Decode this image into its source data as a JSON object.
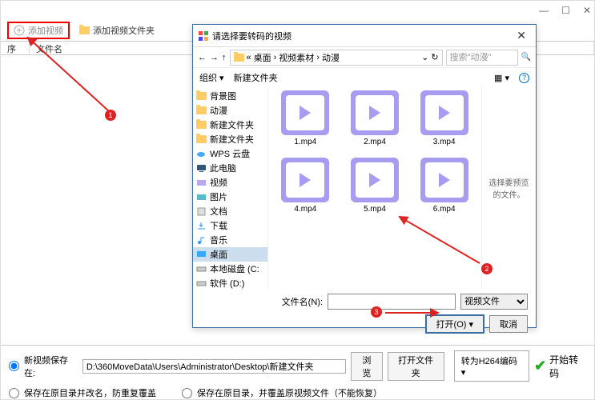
{
  "titlebar": {
    "min": "—",
    "max": "☐",
    "close": "✕"
  },
  "toolbar": {
    "add_video": "添加视频",
    "add_folder": "添加视频文件夹"
  },
  "list_header": {
    "index": "序号",
    "name": "文件名"
  },
  "dialog": {
    "title": "请选择要转码的视频",
    "close": "✕",
    "nav": {
      "back": "←",
      "fwd": "→",
      "up": "↑",
      "crumbs": [
        "«",
        "桌面",
        "›",
        "视频素材",
        "›",
        "动漫"
      ],
      "refresh": "↻",
      "search_placeholder": "搜索\"动漫\"",
      "search_icon": "🔍"
    },
    "tools": {
      "organize": "组织 ▾",
      "newfolder": "新建文件夹",
      "view": "▦ ▾",
      "help": "?"
    },
    "tree": [
      {
        "label": "背景图",
        "icon": "folder"
      },
      {
        "label": "动漫",
        "icon": "folder"
      },
      {
        "label": "新建文件夹",
        "icon": "folder"
      },
      {
        "label": "新建文件夹",
        "icon": "folder"
      },
      {
        "label": "WPS 云盘",
        "icon": "cloud"
      },
      {
        "label": "此电脑",
        "icon": "pc",
        "bold": true
      },
      {
        "label": "视频",
        "icon": "video"
      },
      {
        "label": "图片",
        "icon": "pic"
      },
      {
        "label": "文档",
        "icon": "doc"
      },
      {
        "label": "下载",
        "icon": "download"
      },
      {
        "label": "音乐",
        "icon": "music"
      },
      {
        "label": "桌面",
        "icon": "desktop",
        "selected": true
      },
      {
        "label": "本地磁盘 (C:",
        "icon": "disk"
      },
      {
        "label": "软件 (D:)",
        "icon": "disk"
      }
    ],
    "files": [
      {
        "name": "1.mp4"
      },
      {
        "name": "2.mp4"
      },
      {
        "name": "3.mp4"
      },
      {
        "name": "4.mp4"
      },
      {
        "name": "5.mp4"
      },
      {
        "name": "6.mp4"
      }
    ],
    "preview_text": "选择要预览的文件。",
    "footer": {
      "filename_label": "文件名(N):",
      "filter": "视频文件",
      "open": "打开(O) ▾",
      "cancel": "取消"
    }
  },
  "footer": {
    "save_label": "新视频保存在:",
    "save_path": "D:\\360MoveData\\Users\\Administrator\\Desktop\\新建文件夹",
    "browse": "浏览",
    "open_folder": "打开文件夹",
    "opt1": "保存在原目录并改名，防重复覆盖",
    "opt2": "保存在原目录，并覆盖原视频文件（不能恢复）",
    "encode": "转为H264编码 ▾",
    "start": "开始转码"
  },
  "markers": {
    "m1": "1",
    "m2": "2",
    "m3": "3"
  }
}
